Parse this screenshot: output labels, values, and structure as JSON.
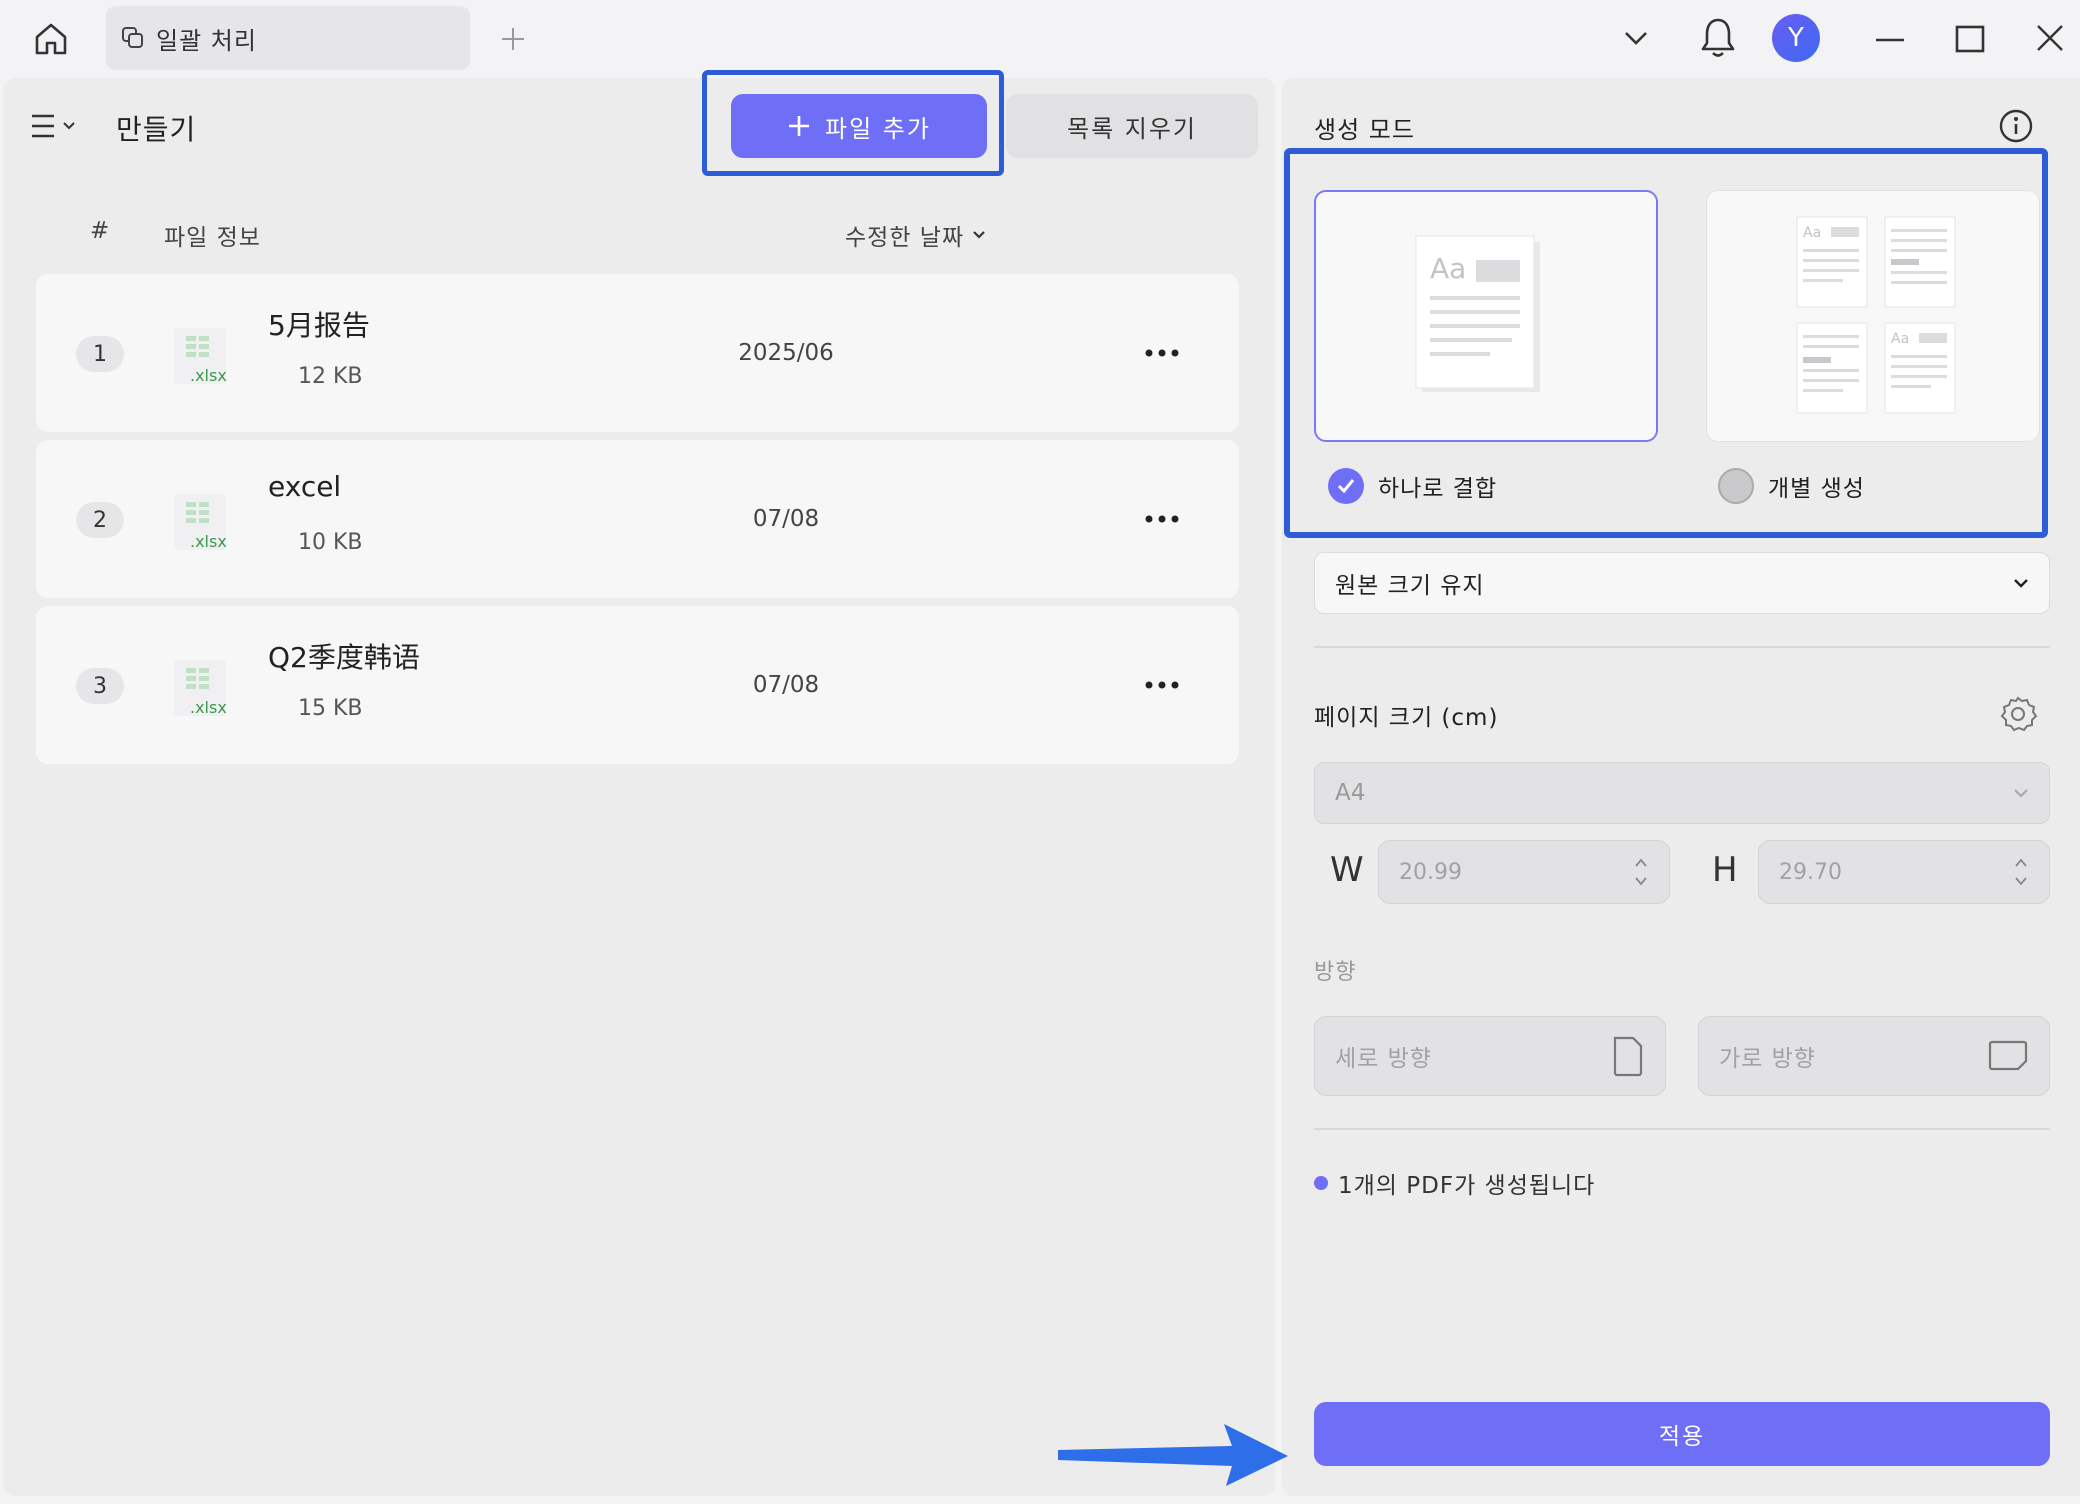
{
  "titlebar": {
    "tab_label": "일괄 처리",
    "avatar_letter": "Y"
  },
  "header": {
    "title": "만들기",
    "add_file_label": "파일 추가",
    "clear_list_label": "목록 지우기"
  },
  "table": {
    "col_num": "#",
    "col_info": "파일 정보",
    "col_date": "수정한 날짜",
    "rows": [
      {
        "num": "1",
        "name": "5月报告",
        "ext": ".xlsx",
        "size": "12 KB",
        "date": "2025/06"
      },
      {
        "num": "2",
        "name": "excel",
        "ext": ".xlsx",
        "size": "10 KB",
        "date": "07/08"
      },
      {
        "num": "3",
        "name": "Q2季度韩语",
        "ext": ".xlsx",
        "size": "15 KB",
        "date": "07/08"
      }
    ]
  },
  "settings": {
    "mode_title": "생성 모드",
    "mode_combine": "하나로 결합",
    "mode_separate": "개별 생성",
    "combine_checked": true,
    "size_option": "원본 크기 유지",
    "page_size_label": "페이지 크기 (cm)",
    "page_size_value": "A4",
    "width_letter": "W",
    "width_value": "20.99",
    "height_letter": "H",
    "height_value": "29.70",
    "orientation_label": "방향",
    "portrait_label": "세로 방향",
    "landscape_label": "가로 방향",
    "note": "1개의 PDF가 생성됩니다",
    "apply_label": "적용"
  },
  "colors": {
    "accent": "#6f6ef7",
    "highlight": "#2e5bd8",
    "excel_green": "#3c9a4a"
  }
}
